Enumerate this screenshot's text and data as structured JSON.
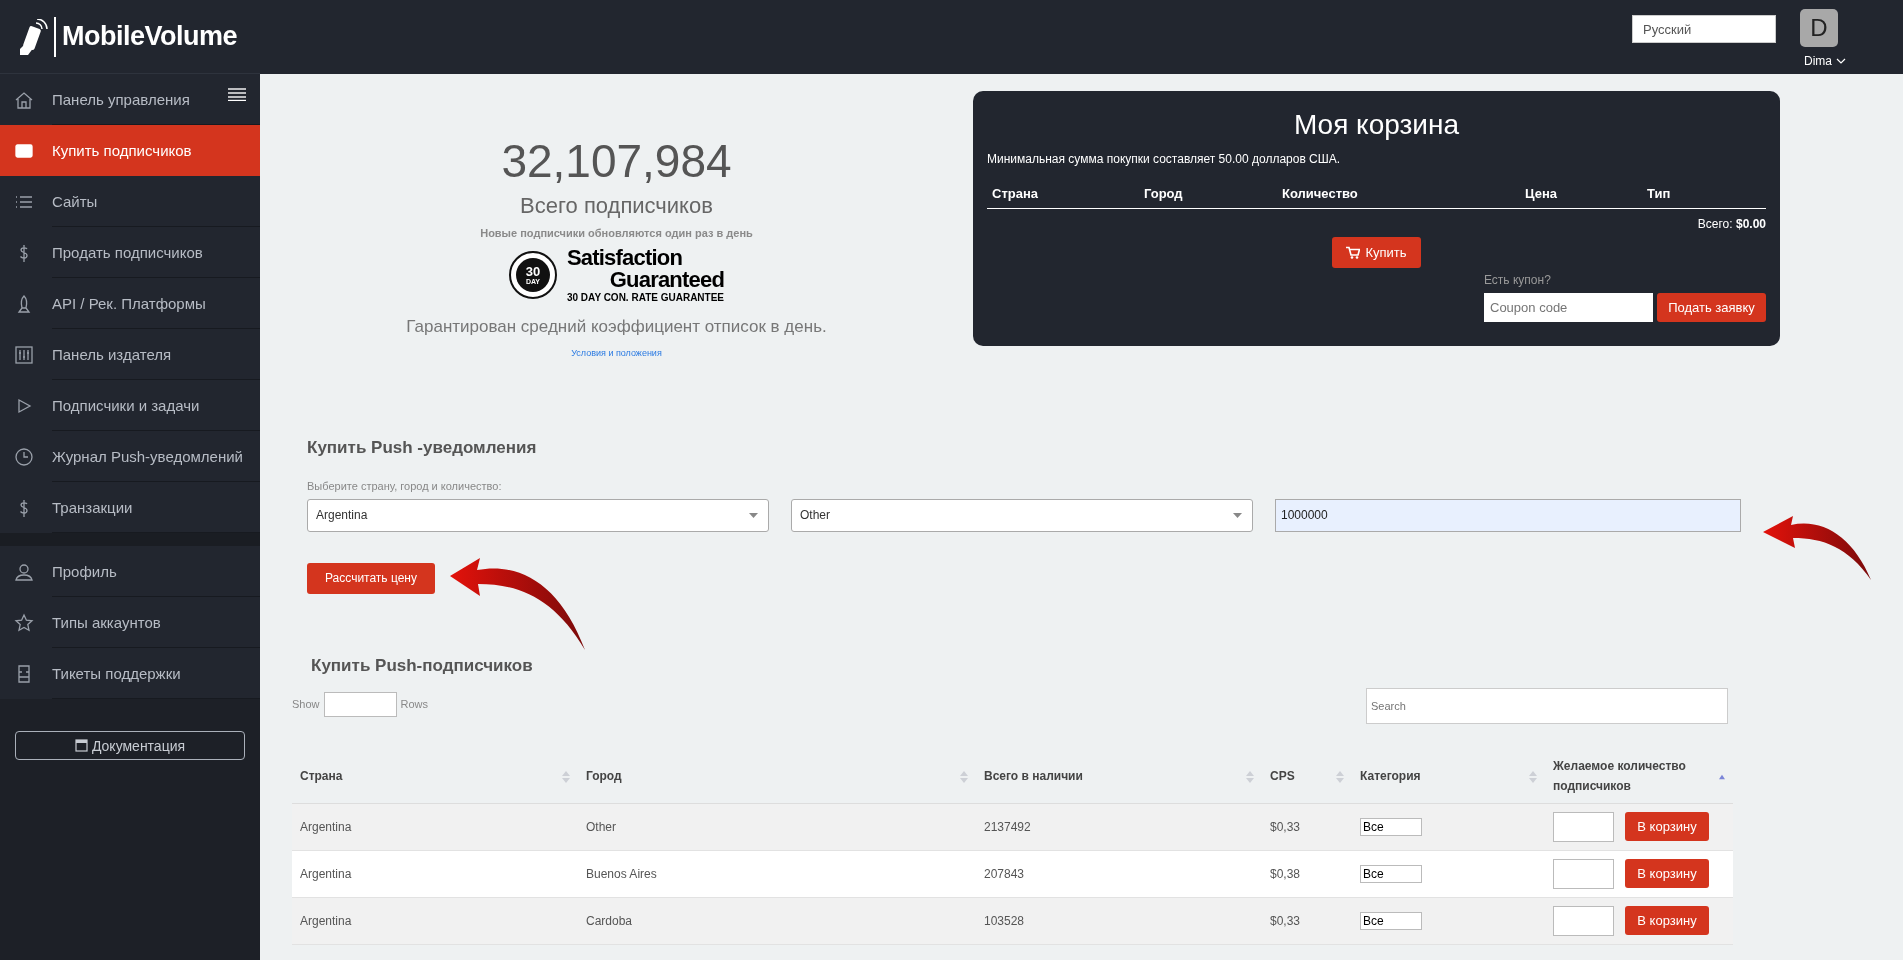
{
  "header": {
    "language": {
      "value": "Русский"
    },
    "user": {
      "initial": "D",
      "name": "Dima"
    }
  },
  "sidebar": {
    "logo": "MobileVolume",
    "groups": [
      {
        "items": [
          {
            "label": "Панель управления",
            "selected": false
          },
          {
            "label": "Купить подписчиков",
            "selected": true
          },
          {
            "label": "Сайты",
            "selected": false
          },
          {
            "label": "Продать подписчиков",
            "selected": false
          },
          {
            "label": "API / Рек. Платформы",
            "selected": false
          },
          {
            "label": "Панель издателя",
            "selected": false
          },
          {
            "label": "Подписчики и задачи",
            "selected": false
          },
          {
            "label": "Журнал Push-уведомлений",
            "selected": false
          },
          {
            "label": "Транзакции",
            "selected": false
          }
        ]
      },
      {
        "items": [
          {
            "label": "Профиль",
            "selected": false
          },
          {
            "label": "Типы аккаунтов",
            "selected": false
          },
          {
            "label": "Тикеты поддержки",
            "selected": false
          }
        ]
      }
    ],
    "doc_button": "Документация"
  },
  "stats": {
    "total": "32,107,984",
    "total_label": "Всего подписчиков",
    "note": "Новые подписчики обновляются один раз в день",
    "badge": {
      "seal_number": "30",
      "seal_unit": "DAY",
      "title": "Satisfaction",
      "subtitle": "Guaranteed",
      "tagline": "30 DAY CON. RATE GUARANTEE"
    },
    "guarantee": "Гарантирован средний коэффициент отписок в день.",
    "terms_link": "Условия и положения"
  },
  "cart": {
    "title": "Моя корзина",
    "min_note": "Минимальная сумма покупки составляет 50.00 долларов США.",
    "columns": [
      "Страна",
      "Город",
      "Количество",
      "Цена",
      "Тип"
    ],
    "total_label": "Всего:",
    "total_value": "$0.00",
    "buy_button": "Купить",
    "coupon_label": "Есть купон?",
    "coupon": {
      "placeholder": "Coupon code"
    },
    "apply_button": "Подать заявку"
  },
  "push_form": {
    "title": "Купить Push -уведомления",
    "label": "Выберите страну, город и количество:",
    "country": {
      "value": "Argentina"
    },
    "city": {
      "value": "Other"
    },
    "quantity": {
      "value": "1000000"
    },
    "calc_button": "Рассчитать цену"
  },
  "subscribers": {
    "title": "Купить Push-подписчиков",
    "show_label": "Show",
    "rows_label": "Rows",
    "search": {
      "placeholder": "Search"
    },
    "table": {
      "columns": [
        {
          "label": "Страна",
          "sorted": false
        },
        {
          "label": "Город",
          "sorted": false
        },
        {
          "label": "Всего в наличии",
          "sorted": false
        },
        {
          "label": "CPS",
          "sorted": false
        },
        {
          "label": "Категория",
          "sorted": false
        },
        {
          "label": "Желаемое количество подписчиков",
          "sorted": true
        }
      ],
      "rows": [
        {
          "country": "Argentina",
          "city": "Other",
          "available": "2137492",
          "cps": "$0,33",
          "category": "Все",
          "button": "В корзину"
        },
        {
          "country": "Argentina",
          "city": "Buenos Aires",
          "available": "207843",
          "cps": "$0,38",
          "category": "Все",
          "button": "В корзину"
        },
        {
          "country": "Argentina",
          "city": "Cardoba",
          "available": "103528",
          "cps": "$0,33",
          "category": "Все",
          "button": "В корзину"
        }
      ]
    }
  }
}
